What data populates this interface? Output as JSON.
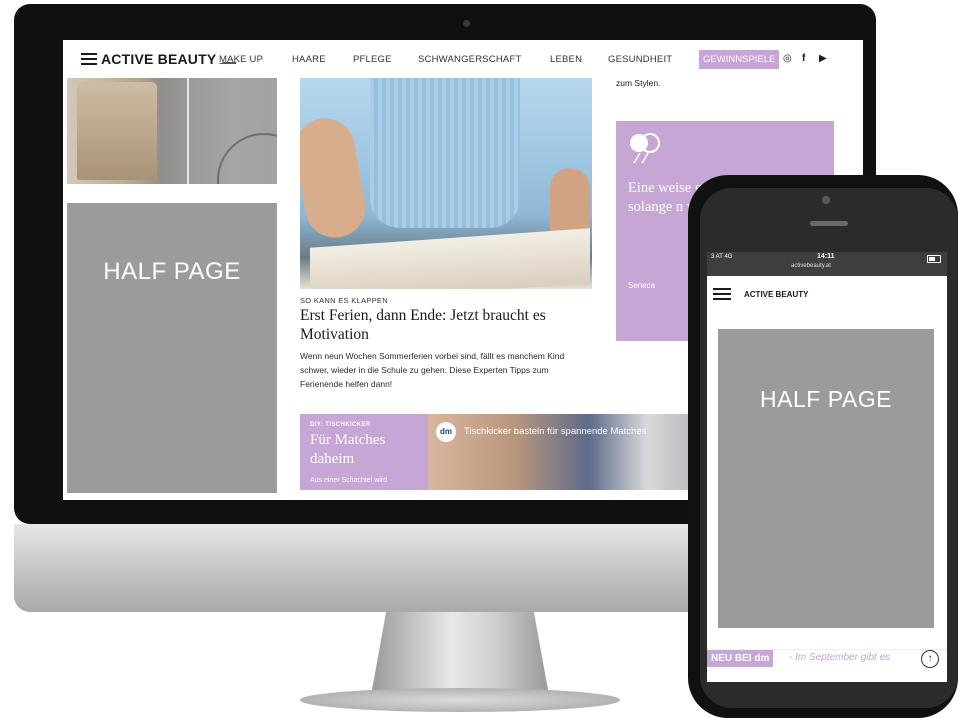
{
  "desktop": {
    "nav": {
      "brand": "ACTIVE BEAUTY",
      "items": [
        "MAKE UP",
        "HAARE",
        "PFLEGE",
        "SCHWANGERSCHAFT",
        "LEBEN",
        "GESUNDHEIT"
      ],
      "cta": "GEWINNSPIELE",
      "social_icons": [
        "instagram-icon",
        "facebook-icon",
        "youtube-icon"
      ]
    },
    "ad_slot_label": "HALF PAGE",
    "article": {
      "kicker": "SO KANN ES KLAPPEN",
      "headline": "Erst Ferien, dann Ende: Jetzt braucht es Motivation",
      "teaser": "Wenn neun Wochen Sommerferien vorbei sind, fällt es manchem Kind schwer, wieder in die Schule zu gehen. Diese Experten Tipps zum Ferienende helfen dann!"
    },
    "banner": {
      "kicker": "DIY: TISCHKICKER",
      "title": "Für Matches daheim",
      "subtitle": "Aus einer Schachtel wird",
      "video_logo": "dm",
      "video_title": "Tischkicker basteln für spannende Matches"
    },
    "side_text": "zum Stylen.",
    "quote": {
      "text": "Eine weise gelingt ko durch Zu solange n wie man",
      "author": "Seneca"
    },
    "accent_color": "#c5a6d4"
  },
  "mobile": {
    "status": {
      "carrier": "3 AT 4G",
      "time": "14:11",
      "url": "activebeauty.at"
    },
    "brand": "ACTIVE BEAUTY",
    "ad_slot_label": "HALF PAGE",
    "ticker": {
      "badge": "NEU BEI dm",
      "text": "- Im September gibt es"
    },
    "scroll_top_icon": "arrow-up-icon"
  }
}
